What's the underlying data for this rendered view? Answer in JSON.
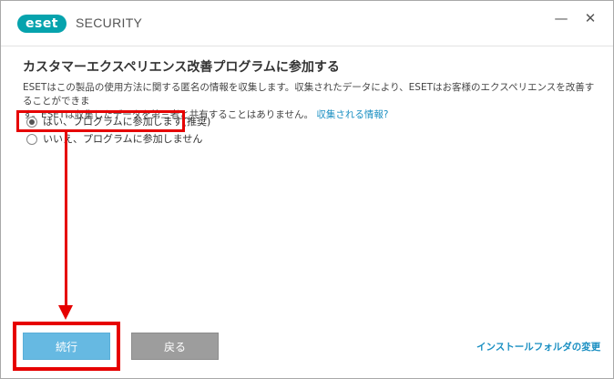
{
  "titlebar": {
    "logo_text": "eset",
    "brand": "SECURITY",
    "minimize_glyph": "—",
    "close_glyph": "✕"
  },
  "main": {
    "heading": "カスタマーエクスペリエンス改善プログラムに参加する",
    "description_line1": "ESETはこの製品の使用方法に関する匿名の情報を収集します。収集されたデータにより、ESETはお客様のエクスペリエンスを改善することができま",
    "description_line2": "す。ESETは収集したデータを第三者と共有することはありません。",
    "description_link": "収集される情報?",
    "options": [
      {
        "label": "はい、プログラムに参加します(推奨)",
        "selected": true
      },
      {
        "label": "いいえ、プログラムに参加しません",
        "selected": false
      }
    ]
  },
  "footer": {
    "continue_label": "続行",
    "back_label": "戻る",
    "install_folder_link": "インストールフォルダの変更"
  },
  "colors": {
    "brand_teal": "#06a3ad",
    "link_blue": "#1a8fc2",
    "continue_button": "#66b9e2",
    "back_button": "#9d9d9d",
    "annotation_red": "#e60000"
  },
  "icons": [
    "minimize-icon",
    "close-icon",
    "radio-checked-icon",
    "radio-unchecked-icon",
    "arrow-down-icon"
  ]
}
